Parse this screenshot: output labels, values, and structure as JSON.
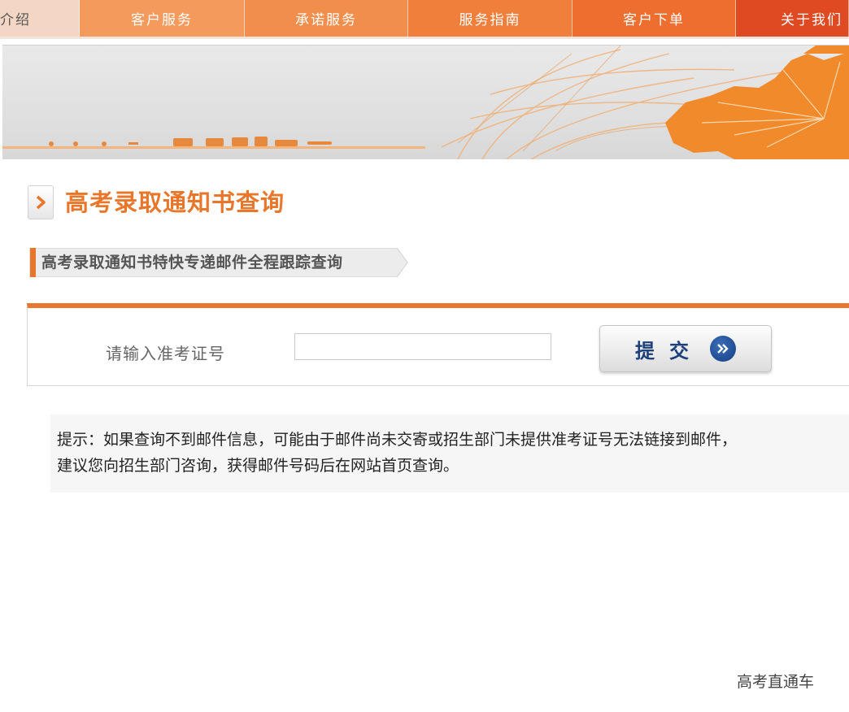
{
  "nav": {
    "items": [
      {
        "label": "介绍",
        "color": "#f3d7c4"
      },
      {
        "label": "客户服务",
        "color": "#f49a5c"
      },
      {
        "label": "承诺服务",
        "color": "#f28e4c"
      },
      {
        "label": "服务指南",
        "color": "#f07f3c"
      },
      {
        "label": "客户下单",
        "color": "#ed6e2e"
      },
      {
        "label": "关于我们",
        "color": "#e04a22"
      }
    ]
  },
  "page": {
    "title": "高考录取通知书查询",
    "subtitle": "高考录取通知书特快专递邮件全程跟踪查询"
  },
  "form": {
    "label": "请输入准考证号",
    "input_value": "",
    "input_placeholder": "",
    "submit_label": "提交"
  },
  "tip": {
    "line1": "提示：如果查询不到邮件信息，可能由于邮件尚未交寄或招生部门未提供准考证号无法链接到邮件，",
    "line2": "建议您向招生部门咨询，获得邮件号码后在网站首页查询。"
  },
  "watermark": "高考直通车",
  "colors": {
    "accent": "#e8772b",
    "button_text": "#1d3f7a"
  }
}
